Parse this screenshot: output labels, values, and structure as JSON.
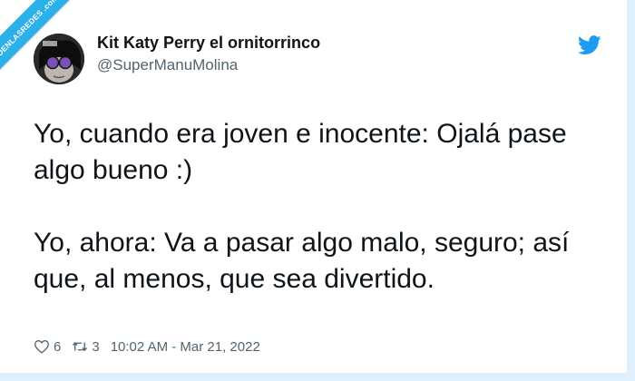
{
  "watermark": {
    "text": "VISTOENLASREDES .com"
  },
  "tweet": {
    "display_name": "Kit Katy Perry el ornitorrinco",
    "handle": "@SuperManuMolina",
    "paragraphs": [
      "Yo, cuando era joven e inocente: Ojalá pase algo bueno :)",
      "Yo, ahora: Va a pasar algo malo, seguro; así que, al menos, que sea divertido."
    ],
    "likes": "6",
    "retweets": "3",
    "timestamp": "10:02 AM - Mar 21, 2022"
  },
  "icons": {
    "logo": "twitter-bird-icon",
    "like": "heart-icon",
    "retweet": "retweet-icon"
  },
  "colors": {
    "brand": "#1d9bf0",
    "frame": "#dfeffb",
    "ribbon": "#2bb0e8",
    "text": "#0f1419",
    "muted": "#536471"
  }
}
